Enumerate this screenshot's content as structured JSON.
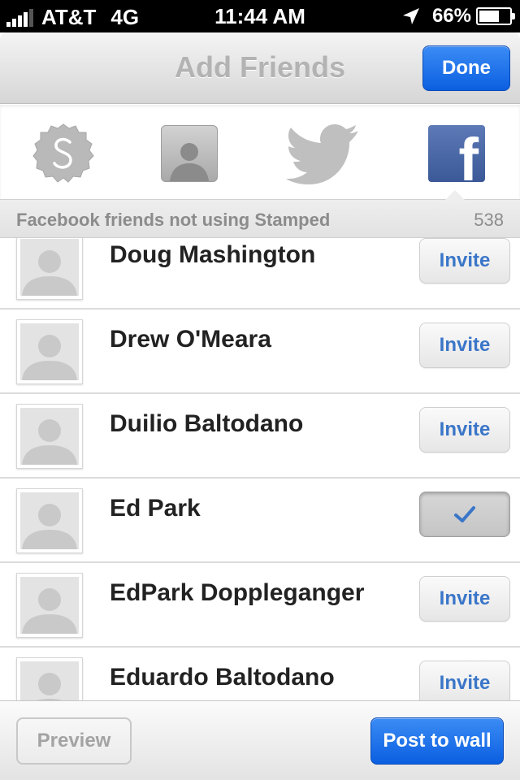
{
  "status_bar": {
    "carrier": "AT&T",
    "network": "4G",
    "time": "11:44 AM",
    "battery": "66%",
    "battery_level": 0.66
  },
  "nav": {
    "title": "Add Friends",
    "done_label": "Done"
  },
  "source_tabs": {
    "items": [
      {
        "name": "stamped",
        "icon": "stamped-badge-icon"
      },
      {
        "name": "contacts",
        "icon": "contact-person-icon"
      },
      {
        "name": "twitter",
        "icon": "twitter-bird-icon"
      },
      {
        "name": "facebook",
        "icon": "facebook-icon",
        "selected": true
      }
    ]
  },
  "section": {
    "title": "Facebook friends not using Stamped",
    "count": "538"
  },
  "friends": [
    {
      "name": "Doug Mashington",
      "invite_label": "Invite",
      "invited": false
    },
    {
      "name": "Drew O'Meara",
      "invite_label": "Invite",
      "invited": false
    },
    {
      "name": "Duilio Baltodano",
      "invite_label": "Invite",
      "invited": false
    },
    {
      "name": "Ed Park",
      "invite_label": "",
      "invited": true
    },
    {
      "name": "EdPark Doppleganger",
      "invite_label": "Invite",
      "invited": false
    },
    {
      "name": "Eduardo Baltodano",
      "invite_label": "Invite",
      "invited": false
    }
  ],
  "toolbar": {
    "preview_label": "Preview",
    "post_label": "Post to wall"
  },
  "colors": {
    "accent_blue": "#1a6ee8",
    "invite_text": "#3a76c8",
    "facebook_blue": "#3b5998"
  }
}
